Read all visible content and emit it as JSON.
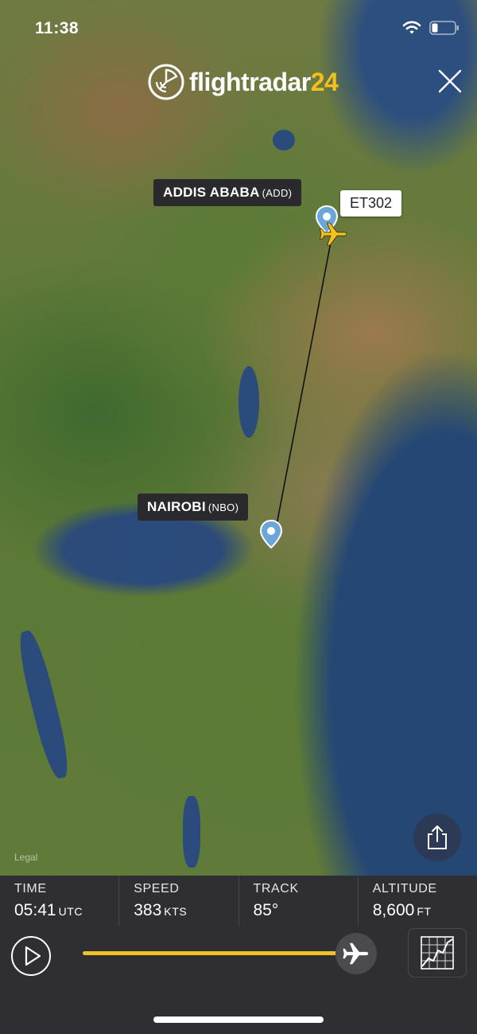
{
  "status_bar": {
    "time": "11:38",
    "icons": [
      "wifi-icon",
      "battery-icon"
    ]
  },
  "app": {
    "logo_text": "flightradar",
    "logo_number": "24"
  },
  "map": {
    "origin": {
      "name": "ADDIS ABABA",
      "code": "(ADD)"
    },
    "destination": {
      "name": "NAIROBI",
      "code": "(NBO)"
    },
    "flight_callsign": "ET302",
    "legal_label": "Legal"
  },
  "stats": [
    {
      "label": "TIME",
      "value": "05:41",
      "unit": "UTC"
    },
    {
      "label": "SPEED",
      "value": "383",
      "unit": "KTS"
    },
    {
      "label": "TRACK",
      "value": "85°",
      "unit": ""
    },
    {
      "label": "ALTITUDE",
      "value": "8,600",
      "unit": "FT"
    }
  ],
  "playback": {
    "progress": 0.95
  },
  "colors": {
    "accent_yellow": "#f2c323",
    "panel_bg": "#2f2e33",
    "pin_blue": "#6aa6d8"
  }
}
